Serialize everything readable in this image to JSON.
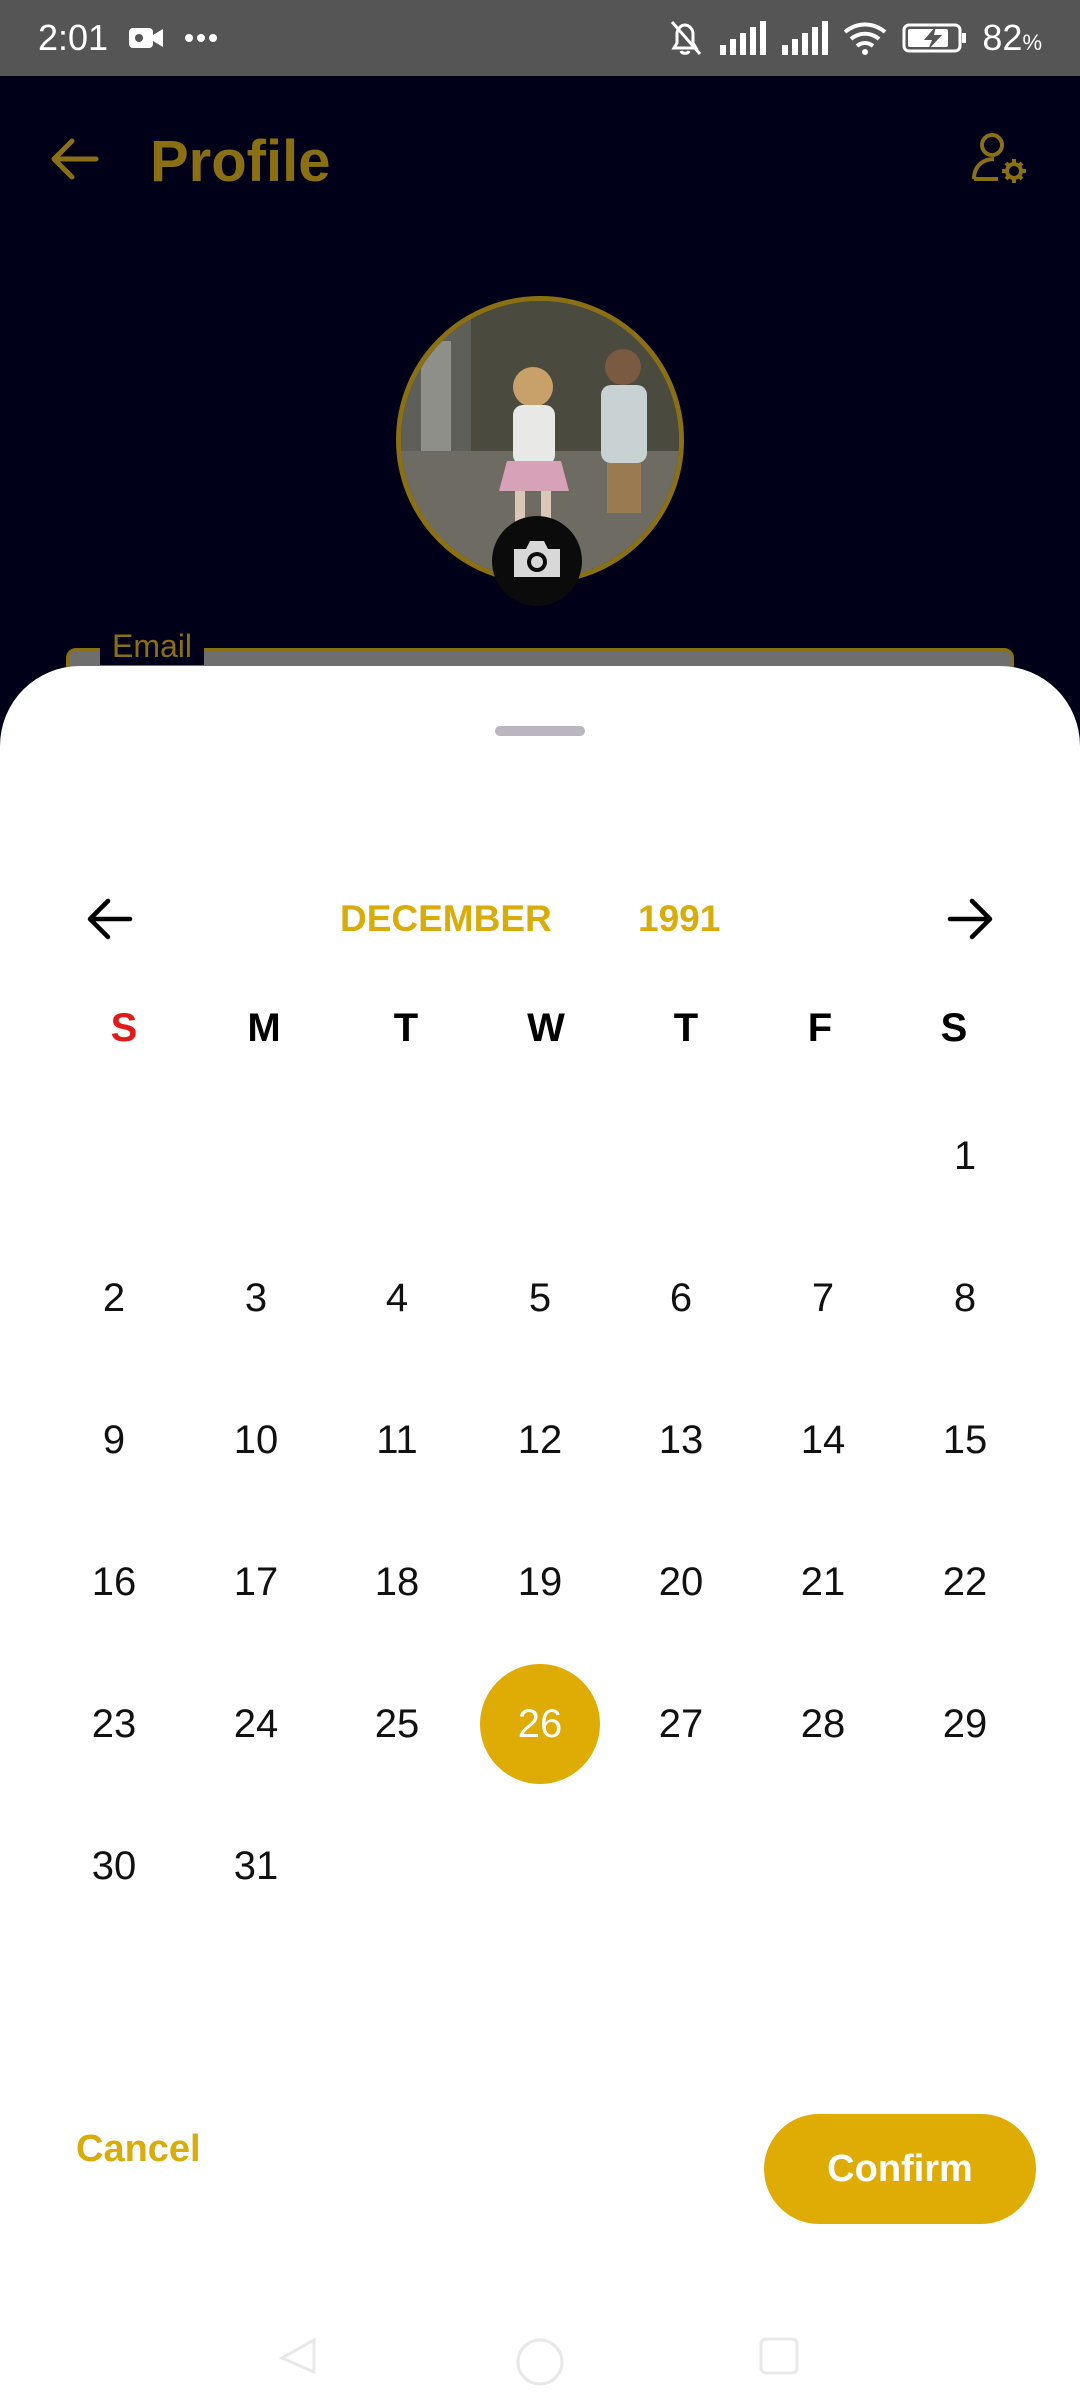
{
  "status_bar": {
    "time": "2:01",
    "battery_percent": "82",
    "battery_unit": "%"
  },
  "app_bar": {
    "title": "Profile"
  },
  "email_field": {
    "label": "Email"
  },
  "date_picker": {
    "month": "DECEMBER",
    "year": "1991",
    "weekdays": [
      "S",
      "M",
      "T",
      "W",
      "T",
      "F",
      "S"
    ],
    "days": [
      [
        "",
        "",
        "",
        "",
        "",
        "",
        "1"
      ],
      [
        "2",
        "3",
        "4",
        "5",
        "6",
        "7",
        "8"
      ],
      [
        "9",
        "10",
        "11",
        "12",
        "13",
        "14",
        "15"
      ],
      [
        "16",
        "17",
        "18",
        "19",
        "20",
        "21",
        "22"
      ],
      [
        "23",
        "24",
        "25",
        "26",
        "27",
        "28",
        "29"
      ],
      [
        "30",
        "31",
        "",
        "",
        "",
        "",
        ""
      ]
    ],
    "selected_day": "26",
    "cancel_label": "Cancel",
    "confirm_label": "Confirm"
  },
  "colors": {
    "accent": "#deac05",
    "sunday": "#e01b1b",
    "app_background": "#000018",
    "dimmed_accent": "#8a7012"
  },
  "icons": {
    "back": "arrow-left-icon",
    "settings": "user-settings-icon",
    "camera": "camera-icon",
    "prev_month": "arrow-left-icon",
    "next_month": "arrow-right-icon"
  }
}
